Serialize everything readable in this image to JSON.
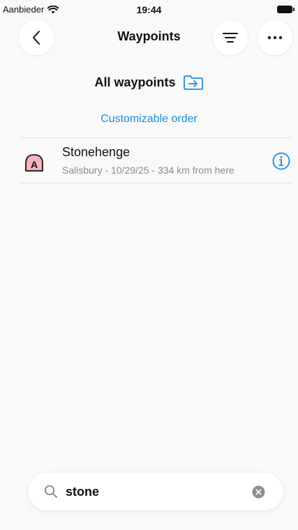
{
  "status": {
    "carrier": "Aanbieder",
    "time": "19:44"
  },
  "nav": {
    "title": "Waypoints"
  },
  "folder": {
    "title": "All waypoints"
  },
  "sort": {
    "label": "Customizable order"
  },
  "waypoints": [
    {
      "marker": "A",
      "name": "Stonehenge",
      "subtitle": "Salisbury - 10/29/25 - 334 km from here"
    }
  ],
  "search": {
    "value": "stone"
  },
  "colors": {
    "accent": "#1a8de0",
    "marker_fill": "#f4b3bd",
    "marker_stroke": "#111111"
  },
  "icons": {
    "back": "chevron-left-icon",
    "filter": "filter-lines-icon",
    "more": "ellipsis-icon",
    "folder": "folder-arrow-icon",
    "info": "info-icon",
    "search": "search-icon",
    "clear": "clear-icon"
  }
}
